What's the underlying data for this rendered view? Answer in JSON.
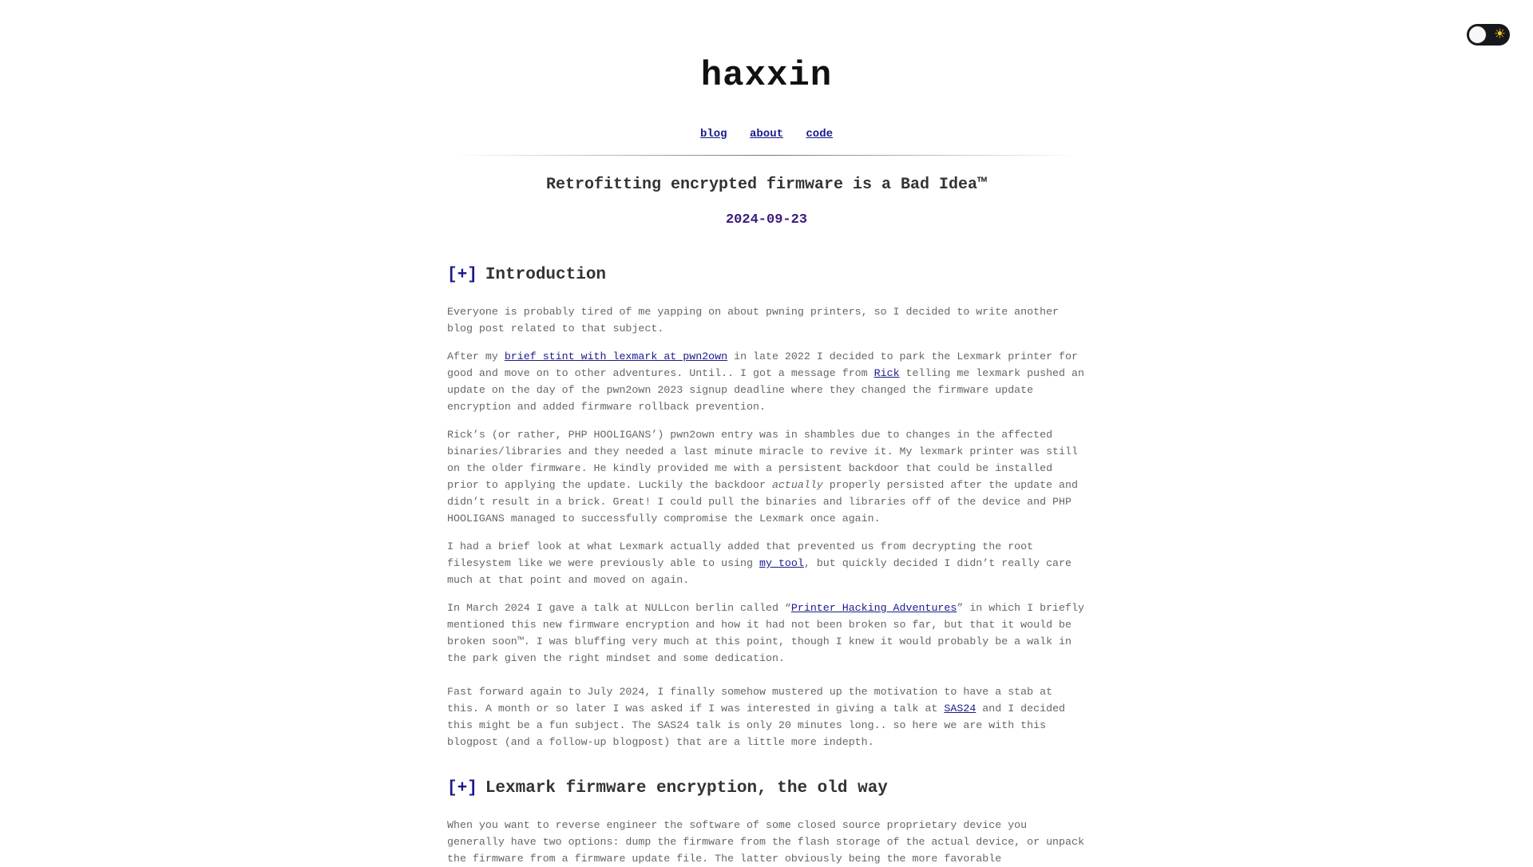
{
  "theme_toggle": {
    "state": "light",
    "icon": "sun-icon",
    "glyph": "☀"
  },
  "site": {
    "title": "haxxin"
  },
  "nav": [
    {
      "label": "blog"
    },
    {
      "label": "about"
    },
    {
      "label": "code"
    }
  ],
  "post": {
    "title": "Retrofitting encrypted firmware is a Bad Idea™",
    "date": "2024-09-23"
  },
  "sections": [
    {
      "toggle": "[+]",
      "heading": "Introduction",
      "paragraphs": [
        {
          "text": "Everyone is probably tired of me yapping on about pwning printers, so I decided to write another blog post related to that subject."
        },
        {
          "t1": "After my ",
          "link1": "brief stint with lexmark at pwn2own",
          "t2": " in late 2022 I decided to park the Lexmark printer for good and move on to other adventures. Until.. I got a message from ",
          "link2": "Rick",
          "t3": " telling me lexmark pushed an update on the day of the pwn2own 2023 signup deadline where they changed the firmware update encryption and added firmware rollback prevention."
        },
        {
          "t1": "Rick’s (or rather, PHP HOOLIGANS’) pwn2own entry was in shambles due to changes in the affected binaries/libraries and they needed a last minute miracle to revive it. My lexmark printer was still on the older firmware. He kindly provided me with a persistent backdoor that could be installed prior to applying the update. Luckily the backdoor ",
          "em": "actually",
          "t2": " properly persisted after the update and didn’t result in a brick. Great! I could pull the binaries and libraries off of the device and PHP HOOLIGANS managed to successfully compromise the Lexmark once again."
        },
        {
          "t1": "I had a brief look at what Lexmark actually added that prevented us from decrypting the root filesystem like we were previously able to using ",
          "link1": "my tool",
          "t2": ", but quickly decided I didn’t really care much at that point and moved on again."
        },
        {
          "t1": "In March 2024 I gave a talk at NULLcon berlin called “",
          "link1": "Printer Hacking Adventures",
          "t2": "” in which I briefly mentioned this new firmware encryption and how it had not been broken so far, but that it would be broken soon™. I was bluffing very much at this point, though I knew it would probably be a walk in the park given the right mindset and some dedication."
        },
        {
          "t1": "Fast forward again to July 2024, I finally somehow mustered up the motivation to have a stab at this. A month or so later I was asked if I was interested in giving a talk at ",
          "link1": "SAS24",
          "t2": " and I decided this might be a fun subject. The SAS24 talk is only 20 minutes long.. so here we are with this blogpost (and a follow-up blogpost) that are a little more indepth."
        }
      ]
    },
    {
      "toggle": "[+]",
      "heading": "Lexmark firmware encryption, the old way",
      "paragraphs": [
        {
          "text": "When you want to reverse engineer the software of some closed source proprietary device you generally have two options: dump the firmware from the flash storage of the actual device, or unpack the firmware from a firmware update file. The latter obviously being the more favorable"
        }
      ]
    }
  ]
}
